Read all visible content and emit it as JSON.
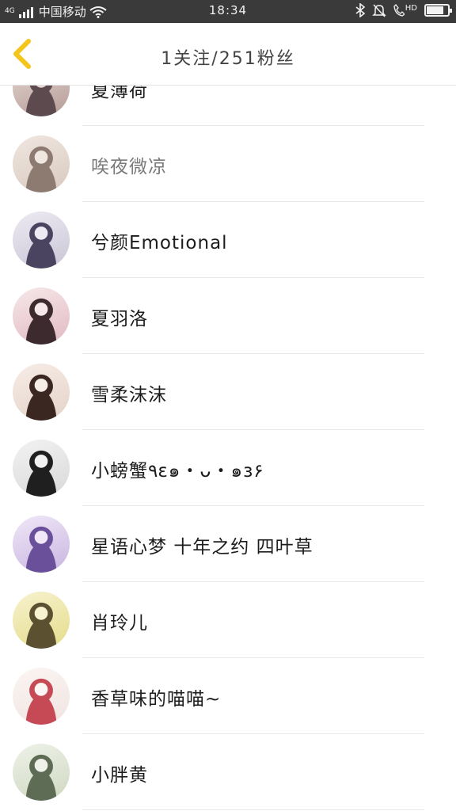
{
  "status_bar": {
    "network": "4G",
    "carrier": "中国移动",
    "time": "18:34",
    "hd_label": "HD",
    "battery_level": 0.75
  },
  "header": {
    "title": "1关注/251粉丝",
    "back_icon": "chevron-left-icon",
    "accent_color": "#f5c51c"
  },
  "followers": [
    {
      "name": "夏薄荷",
      "dim": false,
      "avatar_colors": [
        "#b49a95",
        "#5c4a4e",
        "#e8d9d4"
      ]
    },
    {
      "name": "唉夜微凉",
      "dim": true,
      "avatar_colors": [
        "#d8c9bf",
        "#8d7b72",
        "#f0e7e0"
      ]
    },
    {
      "name": "兮颜Emotional",
      "dim": false,
      "avatar_colors": [
        "#c9c6d6",
        "#4b4460",
        "#eeeaf3"
      ]
    },
    {
      "name": "夏羽洛",
      "dim": false,
      "avatar_colors": [
        "#e2b9c2",
        "#3d2a2e",
        "#f6e8ea"
      ]
    },
    {
      "name": "雪柔沫沫",
      "dim": false,
      "avatar_colors": [
        "#e4d2c8",
        "#3b2722",
        "#f7ede7"
      ]
    },
    {
      "name": "小螃蟹٩ɛ๑・ᴗ・๑ɜ۶",
      "dim": false,
      "avatar_colors": [
        "#d9d9d9",
        "#1f1f1f",
        "#f2f2f2"
      ]
    },
    {
      "name": "星语心梦 十年之约 四叶草",
      "dim": false,
      "avatar_colors": [
        "#c9b4e0",
        "#6a4f9a",
        "#f0e8f8"
      ]
    },
    {
      "name": "肖玲儿",
      "dim": false,
      "avatar_colors": [
        "#e4dc8a",
        "#5b5030",
        "#f7f2cf"
      ]
    },
    {
      "name": "香草味的喵喵~",
      "dim": false,
      "avatar_colors": [
        "#f0e4e0",
        "#c54a55",
        "#fbf5f3"
      ]
    },
    {
      "name": "小胖黄",
      "dim": false,
      "avatar_colors": [
        "#cfd8c2",
        "#5e6b55",
        "#eef2e8"
      ]
    }
  ]
}
